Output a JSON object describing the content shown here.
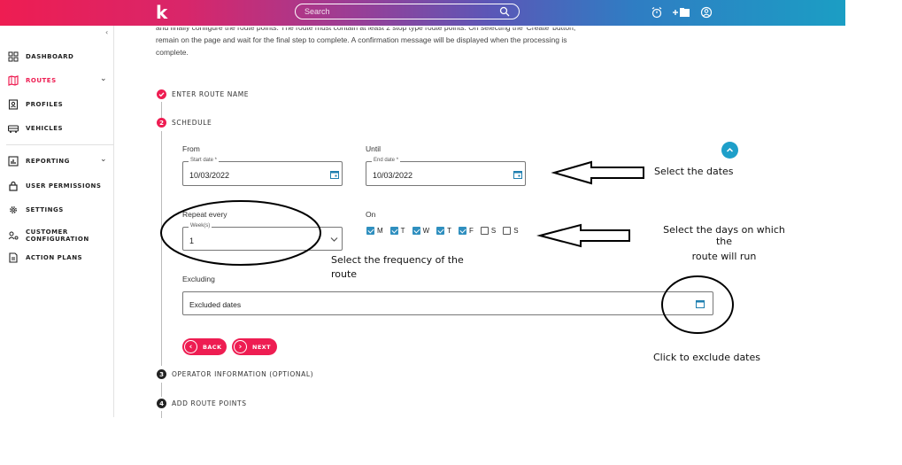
{
  "header": {
    "logo": "k",
    "search_placeholder": "Search"
  },
  "sidebar": {
    "items": [
      {
        "label": "DASHBOARD"
      },
      {
        "label": "ROUTES"
      },
      {
        "label": "PROFILES"
      },
      {
        "label": "VEHICLES"
      },
      {
        "label": "REPORTING"
      },
      {
        "label": "USER PERMISSIONS"
      },
      {
        "label": "SETTINGS"
      },
      {
        "label": "CUSTOMER"
      },
      {
        "label": "ACTION PLANS"
      }
    ],
    "customer_line2": "CONFIGURATION"
  },
  "intro": {
    "line1": "and finally configure the route points. The route must contain at least 2 stop type route points. On selecting the 'Create' button,",
    "line2": "remain on the page and wait for the final step to complete. A confirmation message will be displayed when the processing is",
    "line3": "complete."
  },
  "steps": {
    "step1": "ENTER ROUTE NAME",
    "step2_num": "2",
    "step2": "SCHEDULE",
    "step3_num": "3",
    "step3": "OPERATOR INFORMATION (OPTIONAL)",
    "step4_num": "4",
    "step4": "ADD ROUTE POINTS"
  },
  "schedule": {
    "from_label": "From",
    "until_label": "Until",
    "start_legend": "Start date *",
    "start_value": "10/03/2022",
    "end_legend": "End date *",
    "end_value": "10/03/2022",
    "repeat_label": "Repeat every",
    "week_legend": "Week(s)",
    "week_value": "1",
    "on_label": "On",
    "days": [
      {
        "d": "M",
        "checked": true
      },
      {
        "d": "T",
        "checked": true
      },
      {
        "d": "W",
        "checked": true
      },
      {
        "d": "T",
        "checked": true
      },
      {
        "d": "F",
        "checked": true
      },
      {
        "d": "S",
        "checked": false
      },
      {
        "d": "S",
        "checked": false
      }
    ],
    "excluding_label": "Excluding",
    "excluded_placeholder": "Excluded dates",
    "back_label": "BACK",
    "next_label": "NEXT"
  },
  "annotations": {
    "dates": "Select the dates",
    "days_line1": "Select the days on which the",
    "days_line2": "route will run",
    "freq_line1": "Select the frequency of the",
    "freq_line2": "route",
    "exclude": "Click to exclude dates"
  },
  "colors": {
    "brand_pink": "#ee1d52",
    "accent_blue": "#1e9fc9",
    "check_blue": "#2f8fbf"
  }
}
